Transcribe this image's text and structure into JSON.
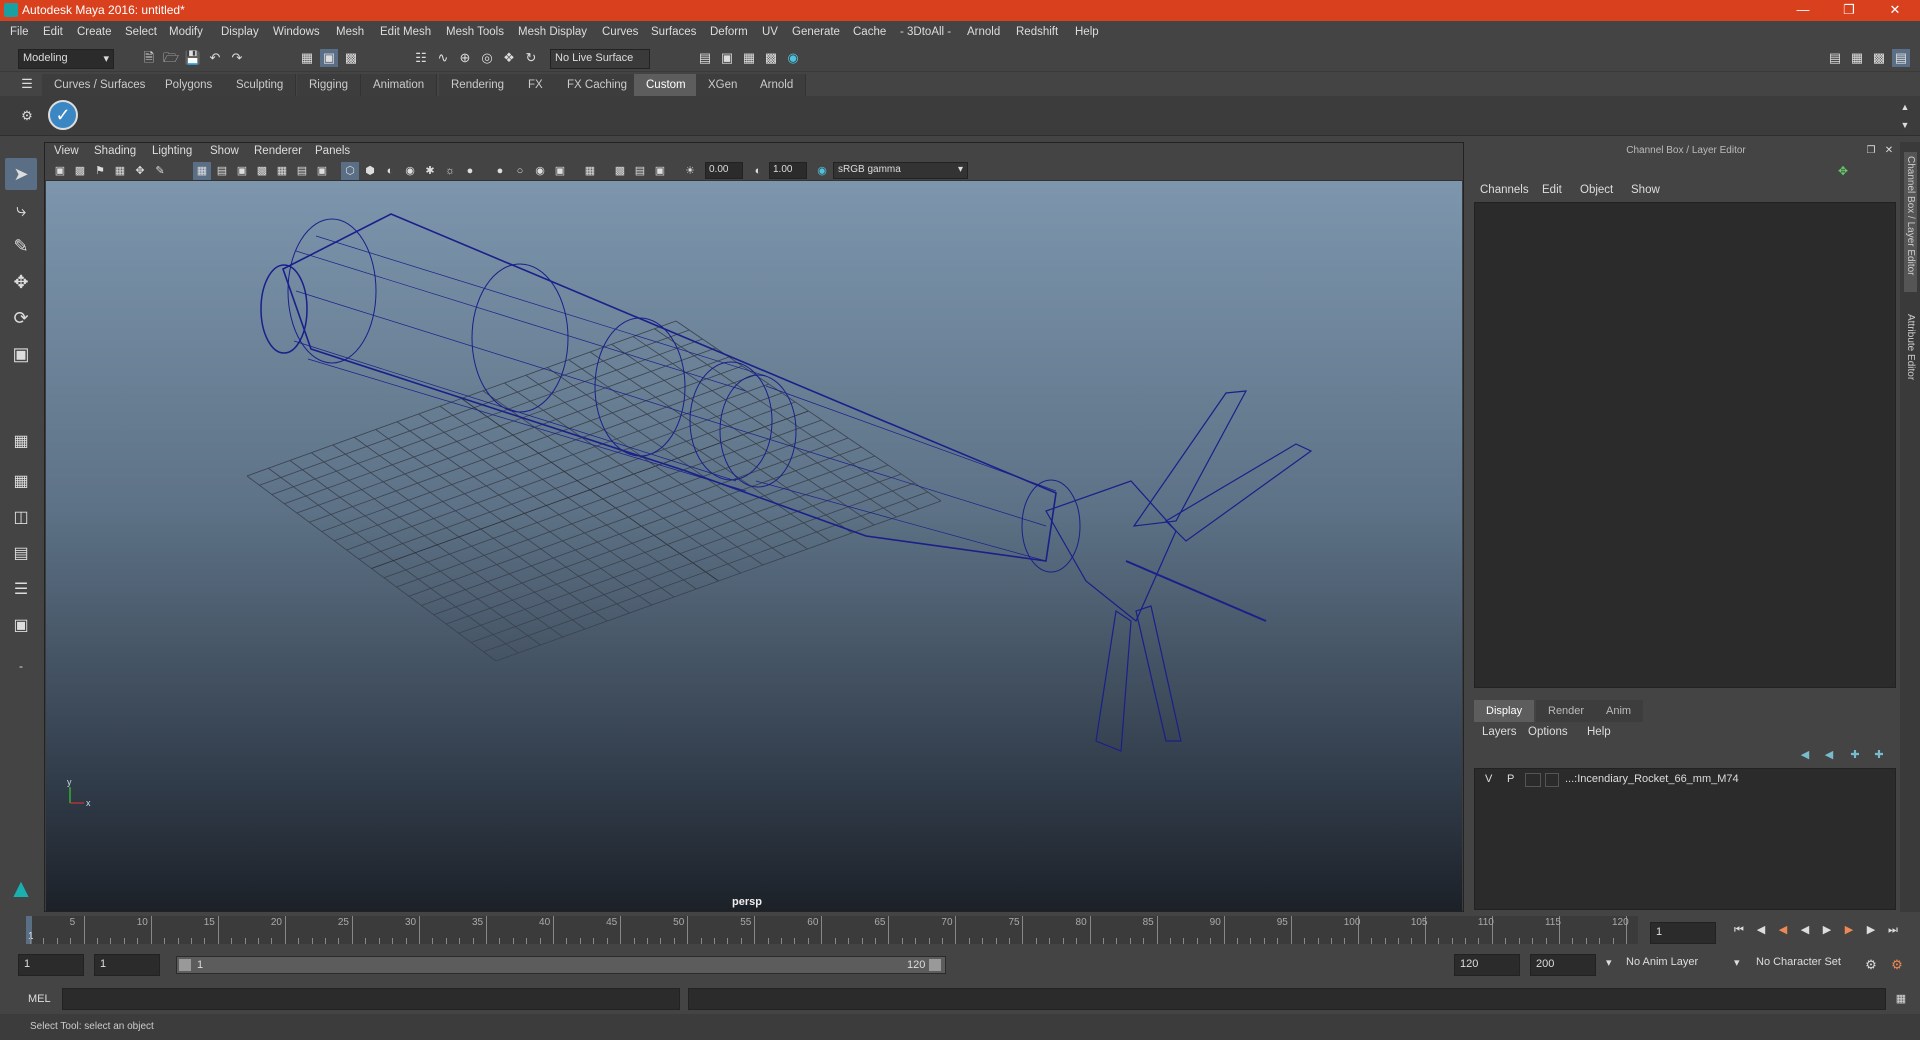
{
  "window": {
    "title": "Autodesk Maya 2016: untitled*"
  },
  "menu": [
    "File",
    "Edit",
    "Create",
    "Select",
    "Modify",
    "Display",
    "Windows",
    "Mesh",
    "Edit Mesh",
    "Mesh Tools",
    "Mesh Display",
    "Curves",
    "Surfaces",
    "Deform",
    "UV",
    "Generate",
    "Cache",
    "- 3DtoAll -",
    "Arnold",
    "Redshift",
    "Help"
  ],
  "status": {
    "mode": "Modeling",
    "live_surface": "No Live Surface"
  },
  "shelf_tabs": [
    "Curves / Surfaces",
    "Polygons",
    "Sculpting",
    "Rigging",
    "Animation",
    "Rendering",
    "FX",
    "FX Caching",
    "Custom",
    "XGen",
    "Arnold"
  ],
  "active_shelf_tab": "Custom",
  "viewport": {
    "menu": [
      "View",
      "Shading",
      "Lighting",
      "Show",
      "Renderer",
      "Panels"
    ],
    "exposure": "0.00",
    "gamma": "1.00",
    "colorspace": "sRGB gamma",
    "camera": "persp",
    "axis_x": "x",
    "axis_y": "y"
  },
  "channel_box": {
    "title": "Channel Box / Layer Editor",
    "menu": [
      "Channels",
      "Edit",
      "Object",
      "Show"
    ],
    "side_tabs": [
      "Channel Box / Layer Editor",
      "Attribute Editor"
    ]
  },
  "layers": {
    "tabs": [
      "Display",
      "Render",
      "Anim"
    ],
    "menu": [
      "Layers",
      "Options",
      "Help"
    ],
    "rows": [
      {
        "v": "V",
        "p": "P",
        "name": "...:Incendiary_Rocket_66_mm_M74"
      }
    ]
  },
  "timeline": {
    "ticks": [
      "5",
      "10",
      "15",
      "20",
      "25",
      "30",
      "35",
      "40",
      "45",
      "50",
      "55",
      "60",
      "65",
      "70",
      "75",
      "80",
      "85",
      "90",
      "95",
      "100",
      "105",
      "110",
      "115",
      "120"
    ],
    "start_label": "1",
    "current_frame": "1"
  },
  "range": {
    "start": "1",
    "playback_start": "1",
    "slider_start": "1",
    "slider_end": "120",
    "playback_end": "120",
    "end": "200",
    "anim_layer": "No Anim Layer",
    "character_set": "No Character Set"
  },
  "command": {
    "label": "MEL"
  },
  "help_line": "Select Tool: select an object",
  "colors": {
    "title_bar": "#d9411e",
    "wire": "#1a1f8a",
    "active_tab": "#5d5d5d"
  }
}
